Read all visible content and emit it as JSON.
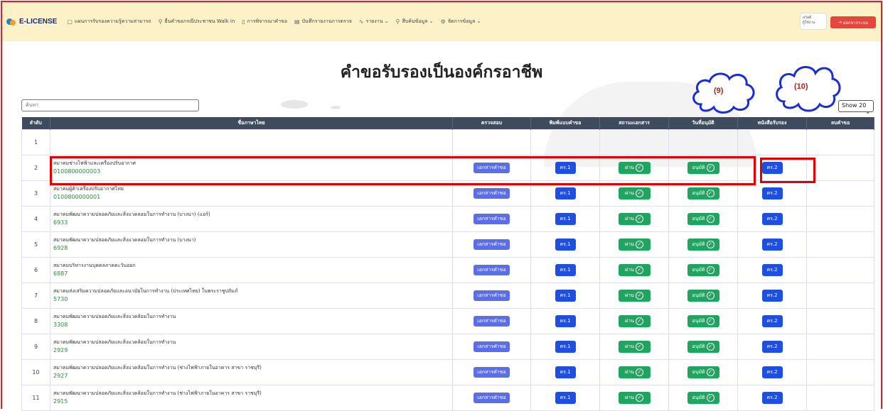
{
  "nav": {
    "brand": "E-LICENSE",
    "items": [
      {
        "icon": "book-icon",
        "glyph": "▢",
        "label": "แผนการรับรองความรู้ความสามารถ"
      },
      {
        "icon": "walk-icon",
        "glyph": "⚲",
        "label": "ยื่นคำขอกรณีประชาชน Walk in"
      },
      {
        "icon": "file-icon",
        "glyph": "▯",
        "label": "การพิจารณาคำขอ"
      },
      {
        "icon": "report-icon",
        "glyph": "▤",
        "label": "บันทึกรายงานการตรวจ"
      },
      {
        "icon": "chart-icon",
        "glyph": "∿",
        "label": "รายงาน ⌄"
      },
      {
        "icon": "search-icon",
        "glyph": "⚲",
        "label": "สืบค้นข้อมูล ⌄"
      },
      {
        "icon": "gear-icon",
        "glyph": "⚙",
        "label": "จัดการข้อมูล ⌄"
      }
    ],
    "user_line1": "สวัสดี",
    "user_line2": "ผู้ใช้งาน",
    "logout_label": "ออกจากระบบ"
  },
  "page": {
    "title": "คำขอรับรองเป็นองค์กรอาชีพ",
    "search_placeholder": "ค้นหา",
    "show_select": "Show 20"
  },
  "annotations": {
    "cloud_9": "(9)",
    "cloud_10": "(10)"
  },
  "table": {
    "headers": [
      "ลำดับ",
      "ชื่อภาษาไทย",
      "ตรวจสอบ",
      "พิมพ์แบบคำขอ",
      "สถานะเอกสาร",
      "วันที่อนุมัติ",
      "หนังสือรับรอง",
      "ลบคำขอ"
    ],
    "doc_label": "เอกสารคำขอ",
    "form_label": "คร.1",
    "status_label": "ผ่าน",
    "approve_label": "อนุมัติ",
    "cert_label": "คร.2",
    "rows": [
      {
        "idx": "1",
        "name": "",
        "code": ""
      },
      {
        "idx": "2",
        "name": "สมาคมช่างไฟฟ้าและเครื่องปรับอากาศ",
        "code": "0100800000003"
      },
      {
        "idx": "3",
        "name": "สมาคมผู้ค้าเครื่องปรับอากาศไทย",
        "code": "0100800000001"
      },
      {
        "idx": "4",
        "name": "สมาคมพัฒนาความปลอดภัยและสิ่งแวดลอมในการทำงาน (บางนา) (แอร์)",
        "code": "6933"
      },
      {
        "idx": "5",
        "name": "สมาคมพัฒนาความปลอดภัยและสิ่งแวดลอมในการทำงาน (บางนา)",
        "code": "6928"
      },
      {
        "idx": "6",
        "name": "สมาคมบริหารงานบุคคลภาคตะวันออก",
        "code": "6887"
      },
      {
        "idx": "7",
        "name": "สมาคมส่งเสริมความปลอดภัยและอนามัยในการทำงาน (ประเทศไทย) ในพระราชูปถัมภ์",
        "code": "5730"
      },
      {
        "idx": "8",
        "name": "สมาคมพัฒนาความปลอดภัยและสิ่งแวดล้อมในการทำงาน",
        "code": "3308"
      },
      {
        "idx": "9",
        "name": "สมาคมพัฒนาความปลอดภัยและสิ่งแวดล้อมในการทำงาน",
        "code": "2929"
      },
      {
        "idx": "10",
        "name": "สมาคมพัฒนาความปลอดภัยและสิ่งแวดล้อมในการทำงาน (ช่างไฟฟ้าภายในอาคาร สาขา ราชบุรี)",
        "code": "2927"
      },
      {
        "idx": "11",
        "name": "สมาคมพัฒนาความปลอดภัยและสิ่งแวดล้อมในการทำงาน (ช่างไฟฟ้าภายในอาคาร สาขา ราชบุรี)",
        "code": "2915"
      }
    ]
  }
}
